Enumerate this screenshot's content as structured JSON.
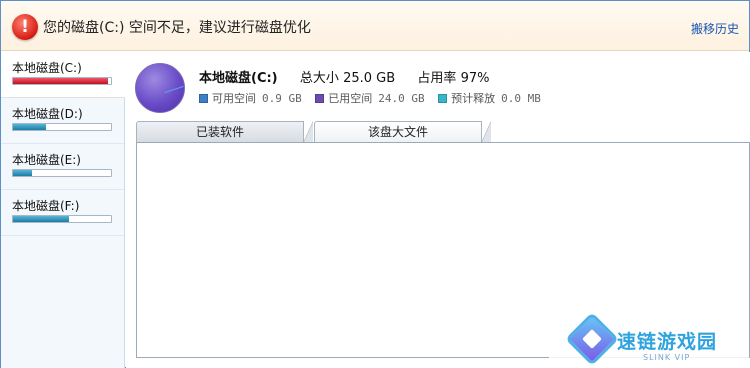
{
  "header": {
    "icon": "warning-icon",
    "title": "您的磁盘(C:) 空间不足，建议进行磁盘优化",
    "link": "搬移历史"
  },
  "sidebar": {
    "items": [
      {
        "label": "本地磁盘(C:)",
        "usage": 0.97,
        "bar_color": "#c81a27",
        "selected": true
      },
      {
        "label": "本地磁盘(D:)",
        "usage": 0.34,
        "bar_color": "#1f86b5",
        "selected": false
      },
      {
        "label": "本地磁盘(E:)",
        "usage": 0.19,
        "bar_color": "#1f86b5",
        "selected": false
      },
      {
        "label": "本地磁盘(F:)",
        "usage": 0.57,
        "bar_color": "#1f86b5",
        "selected": false
      }
    ]
  },
  "disk": {
    "name": "本地磁盘(C:)",
    "total_label": "总大小",
    "total_value": "25.0 GB",
    "usage_label": "占用率",
    "usage_value": "97%",
    "legend": [
      {
        "label": "可用空间",
        "value": "0.9 GB",
        "color": "#3b7fc4"
      },
      {
        "label": "已用空间",
        "value": "24.0 GB",
        "color": "#6d4bb0"
      },
      {
        "label": "预计释放",
        "value": "0.0 MB",
        "color": "#35b7c9"
      }
    ]
  },
  "tabs": [
    {
      "label": "已装软件"
    },
    {
      "label": "该盘大文件"
    }
  ],
  "watermark": {
    "text": "速链游戏园",
    "sub": "SLINK VIP"
  }
}
